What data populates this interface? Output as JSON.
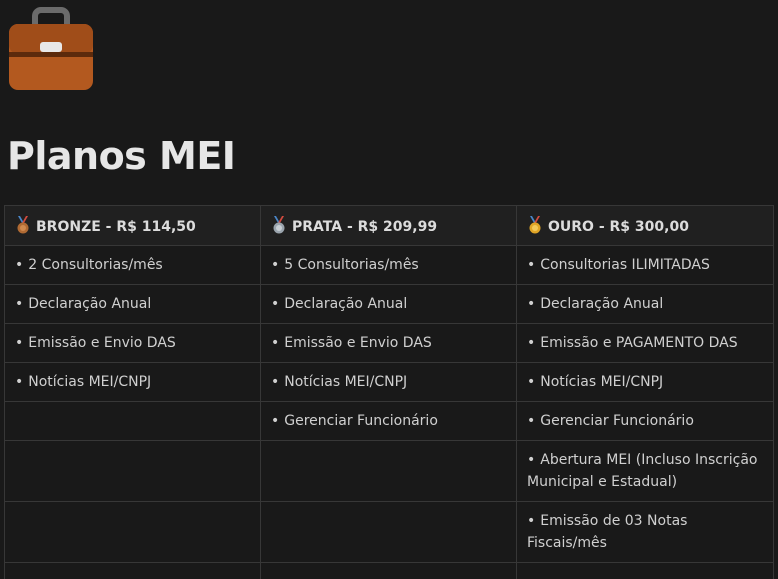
{
  "page": {
    "icon": "briefcase-icon",
    "title": "Planos MEI"
  },
  "colors": {
    "background": "#191919",
    "header_background": "#202020",
    "border": "#373737",
    "bronze": "#b06a33",
    "silver": "#9aa4ad",
    "gold": "#e0a526",
    "ribbon": "#4a86c8"
  },
  "plans": {
    "headers": [
      {
        "medal": "bronze-medal-icon",
        "label": "BRONZE - R$ 114,50"
      },
      {
        "medal": "silver-medal-icon",
        "label": "PRATA - R$ 209,99"
      },
      {
        "medal": "gold-medal-icon",
        "label": "OURO - R$ 300,00"
      }
    ],
    "bullet": "•",
    "rows": [
      [
        "2 Consultorias/mês",
        "5 Consultorias/mês",
        "Consultorias ILIMITADAS"
      ],
      [
        "Declaração Anual",
        "Declaração Anual",
        "Declaração Anual"
      ],
      [
        "Emissão e Envio DAS",
        "Emissão e Envio DAS",
        "Emissão e PAGAMENTO DAS"
      ],
      [
        "Notícias MEI/CNPJ",
        "Notícias MEI/CNPJ",
        "Notícias MEI/CNPJ"
      ],
      [
        "",
        "Gerenciar Funcionário",
        "Gerenciar Funcionário"
      ],
      [
        "",
        "",
        "Abertura MEI (Incluso Inscrição Municipal e Estadual)"
      ],
      [
        "",
        "",
        "Emissão de 03 Notas Fiscais/mês"
      ],
      [
        "",
        "",
        ""
      ]
    ]
  }
}
